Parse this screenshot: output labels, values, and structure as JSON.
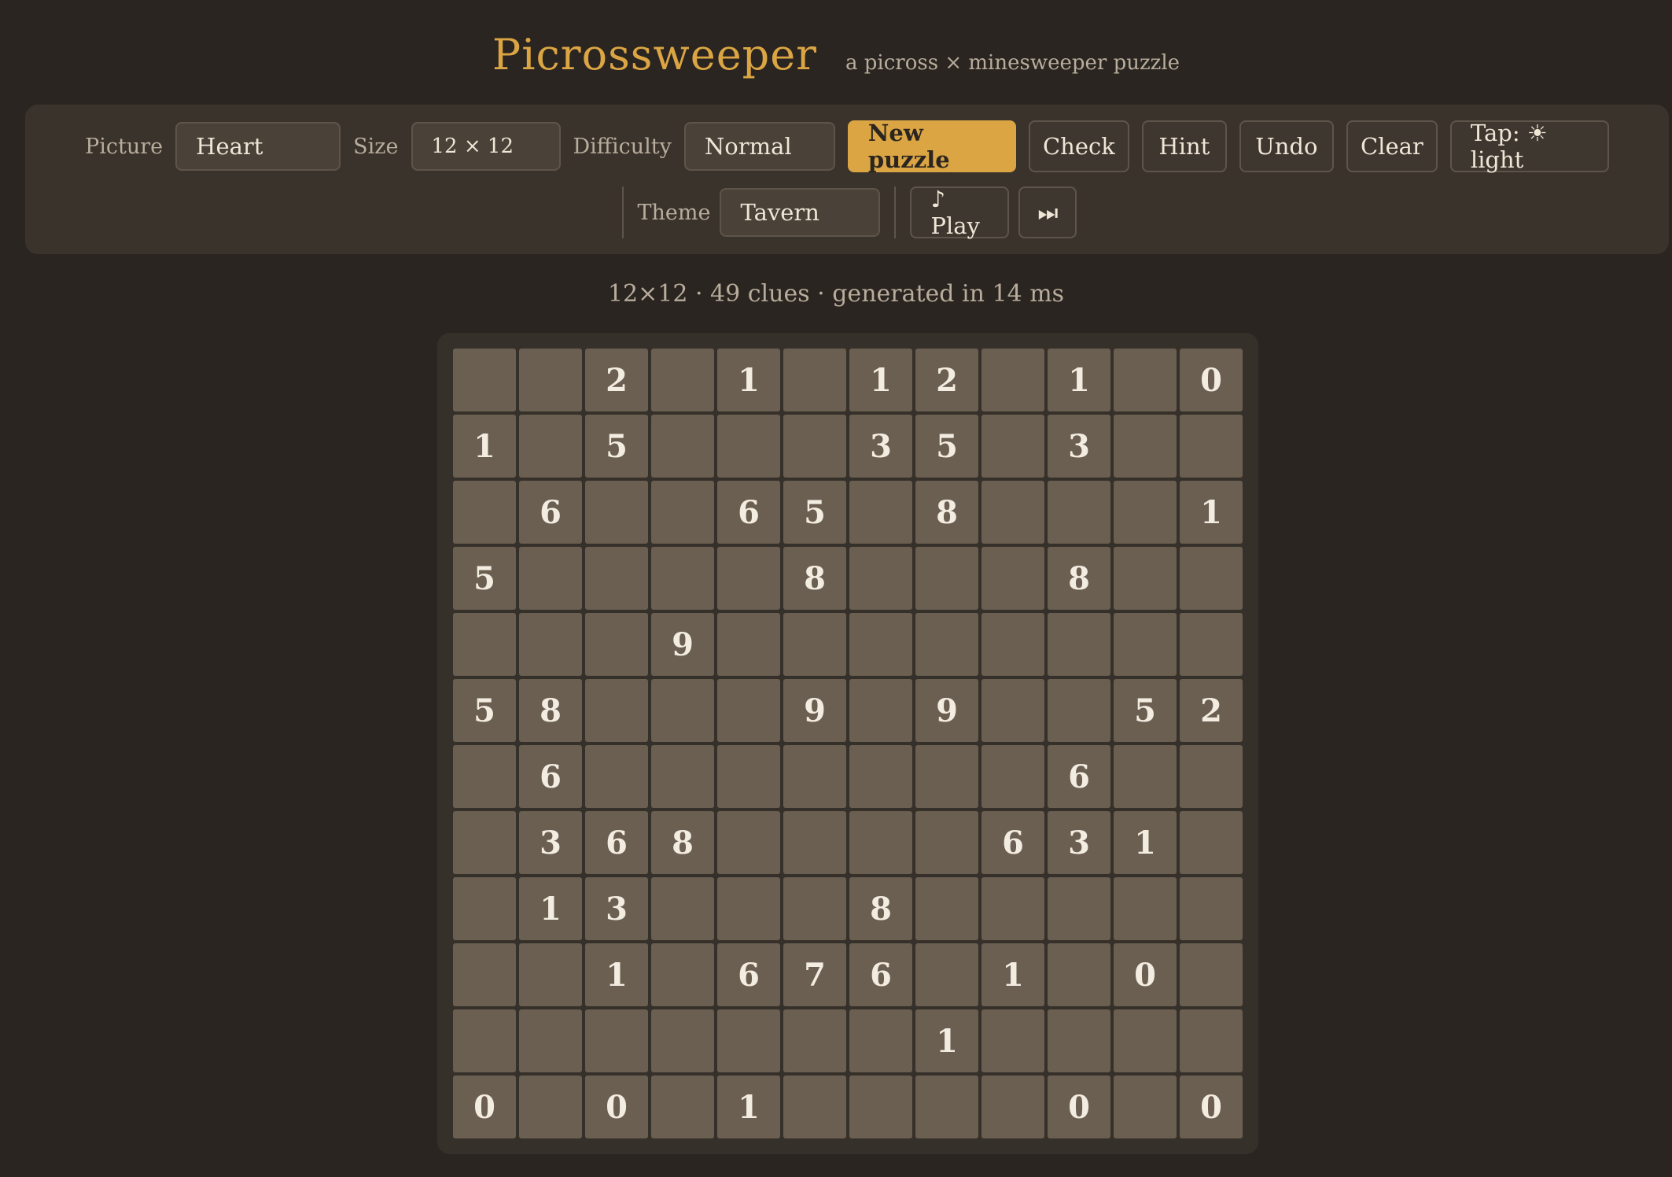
{
  "header": {
    "title": "Picrossweeper",
    "subtitle": "a picross × minesweeper puzzle"
  },
  "toolbar": {
    "picture_label": "Picture",
    "picture_value": "Heart",
    "size_label": "Size",
    "size_value": "12 × 12",
    "difficulty_label": "Difficulty",
    "difficulty_value": "Normal",
    "new_puzzle": "New puzzle",
    "check": "Check",
    "hint": "Hint",
    "undo": "Undo",
    "clear": "Clear",
    "tap_mode": "Tap: ☀ light",
    "theme_label": "Theme",
    "theme_value": "Tavern",
    "play": "♪ Play",
    "skip": "⏭"
  },
  "status": "12×12 · 49 clues · generated in 14 ms",
  "colors": {
    "background": "#2a2520",
    "accent": "#dba544",
    "cell": "#6b5f51"
  },
  "grid": [
    [
      "",
      "",
      "2",
      "",
      "1",
      "",
      "1",
      "2",
      "",
      "1",
      "",
      "0"
    ],
    [
      "1",
      "",
      "5",
      "",
      "",
      "",
      "3",
      "5",
      "",
      "3",
      "",
      ""
    ],
    [
      "",
      "6",
      "",
      "",
      "6",
      "5",
      "",
      "8",
      "",
      "",
      "",
      "1"
    ],
    [
      "5",
      "",
      "",
      "",
      "",
      "8",
      "",
      "",
      "",
      "8",
      "",
      ""
    ],
    [
      "",
      "",
      "",
      "9",
      "",
      "",
      "",
      "",
      "",
      "",
      "",
      ""
    ],
    [
      "5",
      "8",
      "",
      "",
      "",
      "9",
      "",
      "9",
      "",
      "",
      "5",
      "2"
    ],
    [
      "",
      "6",
      "",
      "",
      "",
      "",
      "",
      "",
      "",
      "6",
      "",
      ""
    ],
    [
      "",
      "3",
      "6",
      "8",
      "",
      "",
      "",
      "",
      "6",
      "3",
      "1",
      ""
    ],
    [
      "",
      "1",
      "3",
      "",
      "",
      "",
      "8",
      "",
      "",
      "",
      "",
      ""
    ],
    [
      "",
      "",
      "1",
      "",
      "6",
      "7",
      "6",
      "",
      "1",
      "",
      "0",
      ""
    ],
    [
      "",
      "",
      "",
      "",
      "",
      "",
      "",
      "1",
      "",
      "",
      "",
      ""
    ],
    [
      "0",
      "",
      "0",
      "",
      "1",
      "",
      "",
      "",
      "",
      "0",
      "",
      "0"
    ]
  ]
}
